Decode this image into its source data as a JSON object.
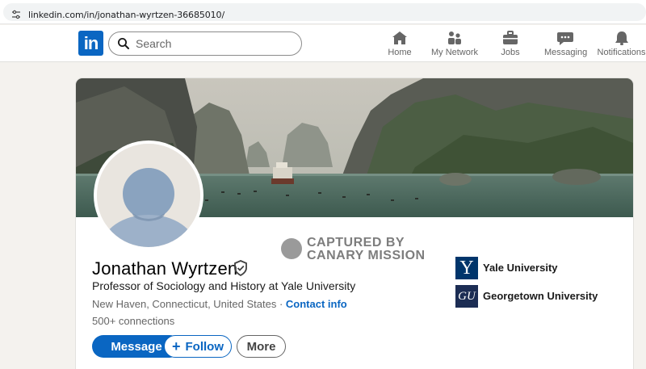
{
  "browser": {
    "url": "linkedin.com/in/jonathan-wyrtzen-36685010/"
  },
  "nav": {
    "logo_text": "in",
    "search_placeholder": "Search",
    "items": [
      {
        "label": "Home",
        "icon": "home-icon"
      },
      {
        "label": "My Network",
        "icon": "network-icon"
      },
      {
        "label": "Jobs",
        "icon": "briefcase-icon"
      },
      {
        "label": "Messaging",
        "icon": "messaging-icon"
      },
      {
        "label": "Notifications",
        "icon": "bell-icon"
      }
    ]
  },
  "watermark": {
    "line1": "CAPTURED BY",
    "line2": "CANARY MISSION"
  },
  "profile": {
    "name": "Jonathan Wyrtzen",
    "headline": "Professor of Sociology and History at Yale University",
    "location": "New Haven, Connecticut, United States",
    "separator": " · ",
    "contact_info": "Contact info",
    "connections": "500+ connections"
  },
  "actions": {
    "message": "Message",
    "follow": "Follow",
    "follow_icon": "+",
    "more": "More"
  },
  "education": [
    {
      "name": "Yale University",
      "logo_text": "Y",
      "color": "#00356b"
    },
    {
      "name": "Georgetown University",
      "logo_text": "GU",
      "color": "#1c2d54"
    }
  ],
  "colors": {
    "brand": "#0a66c2",
    "background": "#f4f2ee"
  }
}
